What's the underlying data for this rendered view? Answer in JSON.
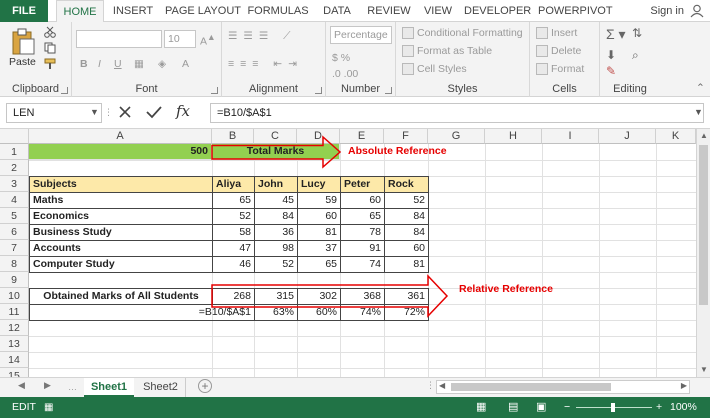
{
  "ribbon_tabs": [
    "FILE",
    "HOME",
    "INSERT",
    "PAGE LAYOUT",
    "FORMULAS",
    "DATA",
    "REVIEW",
    "VIEW",
    "DEVELOPER",
    "POWERPIVOT"
  ],
  "signin": "Sign in",
  "groups": {
    "clipboard": {
      "label": "Clipboard",
      "paste": "Paste"
    },
    "font": {
      "label": "Font",
      "size": "10"
    },
    "alignment": {
      "label": "Alignment"
    },
    "number": {
      "label": "Number",
      "format": "Percentage"
    },
    "styles": {
      "label": "Styles",
      "items": [
        "Conditional Formatting",
        "Format as Table",
        "Cell Styles"
      ]
    },
    "cells": {
      "label": "Cells",
      "items": [
        "Insert",
        "Delete",
        "Format"
      ]
    },
    "editing": {
      "label": "Editing"
    }
  },
  "formula_bar": {
    "name_box": "LEN",
    "fx": "fx",
    "formula": "=B10/$A$1"
  },
  "columns": [
    "A",
    "B",
    "C",
    "D",
    "E",
    "F",
    "G",
    "H",
    "I",
    "J",
    "K"
  ],
  "rows": [
    "1",
    "2",
    "3",
    "4",
    "5",
    "6",
    "7",
    "8",
    "9",
    "10",
    "11",
    "12",
    "13",
    "14",
    "15"
  ],
  "sheet": {
    "a1": "500",
    "total_marks": "Total Marks",
    "absolute_ref": "Absolute Reference",
    "relative_ref": "Relative Reference",
    "headers": [
      "Subjects",
      "Aliya",
      "John",
      "Lucy",
      "Peter",
      "Rock"
    ],
    "data": [
      [
        "Maths",
        "65",
        "45",
        "59",
        "60",
        "52"
      ],
      [
        "Economics",
        "52",
        "84",
        "60",
        "65",
        "84"
      ],
      [
        "Business Study",
        "58",
        "36",
        "81",
        "78",
        "84"
      ],
      [
        "Accounts",
        "47",
        "98",
        "37",
        "91",
        "60"
      ],
      [
        "Computer Study",
        "46",
        "52",
        "65",
        "74",
        "81"
      ]
    ],
    "obtained_label": "Obtained Marks of All Students",
    "obtained": [
      "268",
      "315",
      "302",
      "368",
      "361"
    ],
    "formula_text": "=B10/$A$1",
    "percent": [
      "63%",
      "60%",
      "74%",
      "72%"
    ]
  },
  "sheet_tabs": [
    "Sheet1",
    "Sheet2"
  ],
  "status": {
    "mode": "EDIT",
    "zoom": "100%"
  },
  "colors": {
    "excel_green": "#217346",
    "header_green": "#92d050",
    "header_yellow": "#fde9a9",
    "arrow_red": "#e60000"
  }
}
